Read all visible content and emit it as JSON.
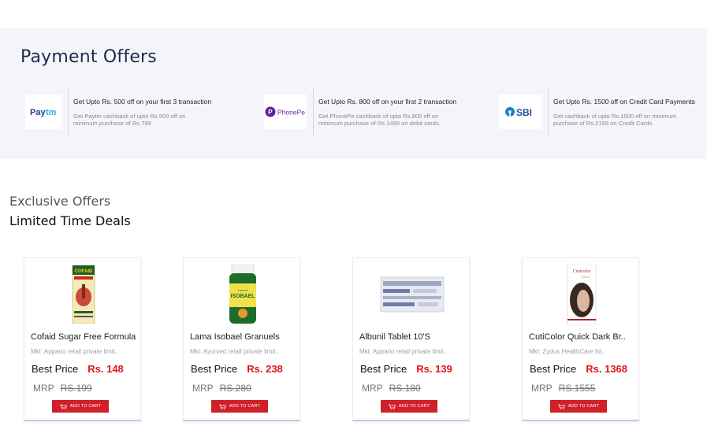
{
  "payment": {
    "title": "Payment Offers",
    "offers": [
      {
        "logo_text": "Paytm",
        "icon": "paytm-logo",
        "headline": "Get Upto Rs. 500 off on your first 3 transaction",
        "description": "Get Paytm cashback of upto Rs.500 off on minimum purchase of Rs.799",
        "color": "#1d3e8f"
      },
      {
        "logo_text": "PhonePe",
        "icon": "phonepe-logo",
        "headline": "Get Upto Rs. 800 off on your first 2 transaction",
        "description": "Get PhonePe cashback of upto Rs.800 off on minimum purchase of Rs.1499 on debit cards.",
        "color": "#5f259f"
      },
      {
        "logo_text": "SBI",
        "icon": "sbi-logo",
        "headline": "Get Upto Rs. 1500 off on Credit Card Payments",
        "description": "Get cashback of upto Rs.1500 off on minimum purchase of Rs.2199 on Credit Cards.",
        "color": "#1f4e9c"
      }
    ]
  },
  "deals": {
    "exclusive_label": "Exclusive Offers",
    "limited_label": "Limited Time Deals",
    "products": [
      {
        "name": "Cofaid Sugar Free Formula",
        "mkt": "Mkt: Appario retail private limit..",
        "best_label": "Best Price",
        "best_price": "Rs. 148",
        "mrp_label": "MRP",
        "mrp": "RS.199",
        "cart_label": "ADD TO CART",
        "image": "cofaid-box"
      },
      {
        "name": "Lama Isobael Granuels",
        "mkt": "Mkt: Ayurved retail private limit..",
        "best_label": "Best Price",
        "best_price": "Rs. 238",
        "mrp_label": "MRP",
        "mrp": "RS.280",
        "cart_label": "ADD TO CART",
        "image": "isobael-jar"
      },
      {
        "name": "Albunil Tablet 10'S",
        "mkt": "Mkt: Appario retail private limit..",
        "best_label": "Best Price",
        "best_price": "Rs. 139",
        "mrp_label": "MRP",
        "mrp": "RS.180",
        "cart_label": "ADD TO CART",
        "image": "tablet-strip"
      },
      {
        "name": "CutiColor Quick Dark Br..",
        "mkt": "Mkt: Zydus HealthCare ltd..",
        "best_label": "Best Price",
        "best_price": "Rs. 1368",
        "mrp_label": "MRP",
        "mrp": "RS.1555",
        "cart_label": "ADD TO CART",
        "image": "cuticolor-box"
      }
    ]
  },
  "colors": {
    "accent_red": "#d0202a",
    "price_red": "#e0161b",
    "band_bg": "#f4f5fb"
  }
}
